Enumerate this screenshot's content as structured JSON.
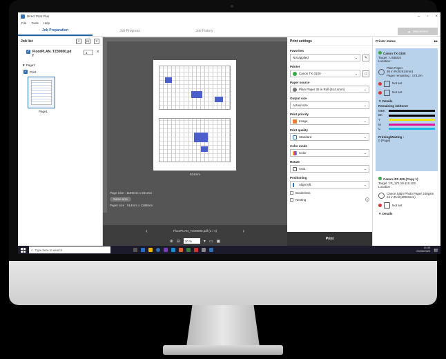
{
  "window": {
    "title": "Direct Print Plus"
  },
  "menu": [
    "File",
    "Tools",
    "Help"
  ],
  "tabs": [
    {
      "label": "Job Preparation",
      "active": true
    },
    {
      "label": "Job Progress",
      "active": false
    },
    {
      "label": "Job History",
      "active": false
    }
  ],
  "disconnect_label": "Disconnect",
  "job_list": {
    "title": "Job list",
    "job_name": "FloorPLAN_TZ30000.pdf",
    "copies": "1",
    "page_group": "Page1",
    "print_label": "Print",
    "thumb_label": "Page1"
  },
  "preview": {
    "size_under_page": "914mm",
    "page_size": "Page Size : 1189mm x 841mm",
    "same_size": "Same size",
    "paper_size": "Paper size : 914mm x 1189mm",
    "file_pager": "FloorPLAN_TZ30000.pdf (1 / 1)",
    "zoom": "20 %"
  },
  "print_settings": {
    "title": "Print settings",
    "favorites": {
      "label": "Favorites",
      "value": "Not applied"
    },
    "printer": {
      "label": "Printer",
      "value": "Canon TX-3100"
    },
    "paper_source": {
      "label": "Paper source",
      "value": "Plain Paper 36 in Roll (914.4mm)"
    },
    "output_size": {
      "label": "Output size",
      "value": "Actual size"
    },
    "print_priority": {
      "label": "Print priority",
      "value": "Image"
    },
    "print_quality": {
      "label": "Print quality",
      "value": "Standard"
    },
    "color_mode": {
      "label": "Color mode",
      "value": "Color"
    },
    "rotate": {
      "label": "Rotate",
      "value": "Auto"
    },
    "positioning": {
      "label": "Positioning",
      "value": "Align left"
    },
    "borderless": "Borderless",
    "nesting": "Nesting",
    "print_button": "Print"
  },
  "printer_status": {
    "title": "Printer status",
    "printer1": {
      "name": "Canon TX-3100",
      "target": "Target : USB002",
      "location": "Location :",
      "media": "Plain Paper",
      "roll": "36 in Roll (914mm)",
      "remaining": "Paper remaining : 173.2m",
      "not_set_1": "Not set",
      "not_set_2": "Not set",
      "details": "Details",
      "ink_title": "Remaining ink/toner",
      "inks": [
        {
          "label": "MBK",
          "color": "#111111"
        },
        {
          "label": "BK",
          "color": "#000000"
        },
        {
          "label": "Y",
          "color": "#f5e400"
        },
        {
          "label": "M",
          "color": "#e0189a"
        },
        {
          "label": "C",
          "color": "#19b6e8"
        }
      ],
      "state": "Printing/Waiting :",
      "state_value": "0 (Page)"
    },
    "printer2": {
      "name": "Canon iPF-300 (Copy 1)",
      "target": "Target : IP_172.19.110.102",
      "location": "Location :",
      "media": "Canon Satin Photo Paper 240gsm",
      "roll": "24 in Roll (609.6mm)",
      "not_set": "Not set",
      "details": "Details"
    }
  },
  "taskbar": {
    "search_placeholder": "Type here to search",
    "time": "14:35",
    "date": "09/05/2022"
  },
  "colors": {
    "accent": "#1d5fa8",
    "selected_card": "#b9d2ec",
    "status_ok": "#39a845",
    "status_error": "#d33333"
  }
}
